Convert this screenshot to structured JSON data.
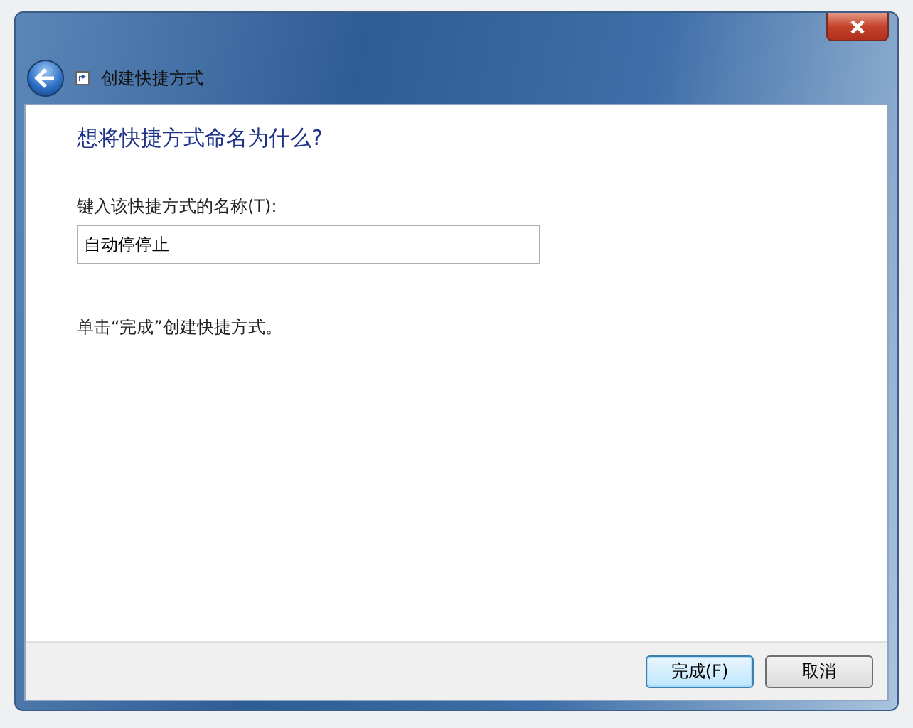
{
  "window": {
    "title": "创建快捷方式"
  },
  "heading": "想将快捷方式命名为什么?",
  "name_field": {
    "label": "键入该快捷方式的名称(T):",
    "value": "自动停停止"
  },
  "instruction": "单击“完成”创建快捷方式。",
  "buttons": [
    {
      "label": "完成(F)",
      "selected": true
    },
    {
      "label": "取消",
      "selected": false
    }
  ]
}
